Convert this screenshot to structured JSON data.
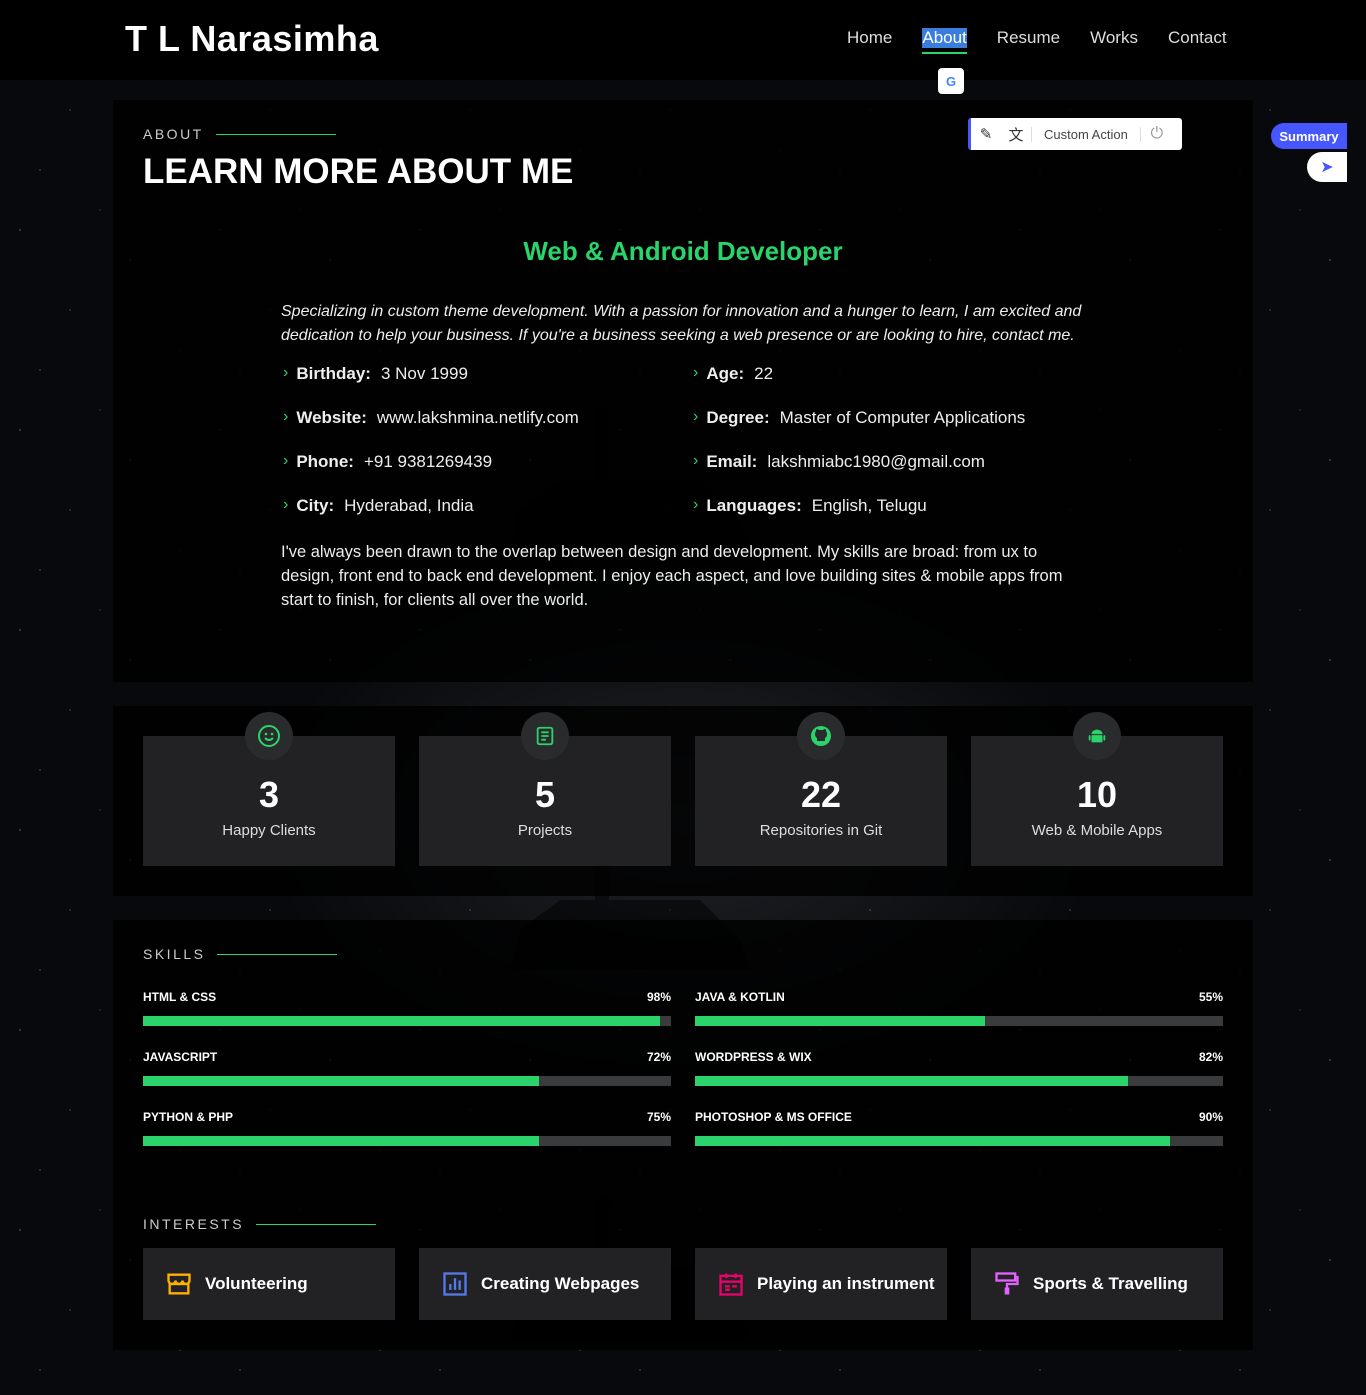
{
  "header": {
    "logo": "T L Narasimha",
    "nav": [
      "Home",
      "About",
      "Resume",
      "Works",
      "Contact"
    ],
    "active_nav": "About"
  },
  "toolbar": {
    "custom_action_label": "Custom Action"
  },
  "summary": {
    "label": "Summary"
  },
  "about": {
    "section_label": "ABOUT",
    "title": "LEARN MORE ABOUT ME",
    "role": "Web & Android Developer",
    "intro": "Specializing in custom theme development. With a passion for innovation and a hunger to learn, I am excited and dedication to help your business. If you're a business seeking a web presence or are looking to hire, contact me.",
    "info": [
      {
        "label": "Birthday:",
        "value": "3 Nov 1999"
      },
      {
        "label": "Age:",
        "value": "22"
      },
      {
        "label": "Website:",
        "value": "www.lakshmina.netlify.com"
      },
      {
        "label": "Degree:",
        "value": "Master of Computer Applications"
      },
      {
        "label": "Phone:",
        "value": "+91 9381269439"
      },
      {
        "label": "Email:",
        "value": "lakshmiabc1980@gmail.com"
      },
      {
        "label": "City:",
        "value": "Hyderabad, India"
      },
      {
        "label": "Languages:",
        "value": "English, Telugu"
      }
    ],
    "bio": "I've always been drawn to the overlap between design and development. My skills are broad: from ux to design, front end to back end development. I enjoy each aspect, and love building sites & mobile apps from start to finish, for clients all over the world."
  },
  "stats": [
    {
      "number": "3",
      "label": "Happy Clients",
      "icon": "smiley-icon"
    },
    {
      "number": "5",
      "label": "Projects",
      "icon": "document-list-icon"
    },
    {
      "number": "22",
      "label": "Repositories in Git",
      "icon": "github-icon"
    },
    {
      "number": "10",
      "label": "Web & Mobile Apps",
      "icon": "android-icon"
    }
  ],
  "skills": {
    "section_label": "SKILLS",
    "items": [
      {
        "name": "HTML & CSS",
        "percent_label": "98%",
        "percent": 98
      },
      {
        "name": "JAVA & KOTLIN",
        "percent_label": "55%",
        "percent": 55
      },
      {
        "name": "JAVASCRIPT",
        "percent_label": "72%",
        "percent": 75
      },
      {
        "name": "WORDPRESS & WIX",
        "percent_label": "82%",
        "percent": 82
      },
      {
        "name": "PYTHON & PHP",
        "percent_label": "75%",
        "percent": 75
      },
      {
        "name": "PHOTOSHOP & MS OFFICE",
        "percent_label": "90%",
        "percent": 90
      }
    ]
  },
  "interests": {
    "section_label": "INTERESTS",
    "items": [
      {
        "label": "Volunteering",
        "icon": "store-icon",
        "color": "#ffb300"
      },
      {
        "label": "Creating Webpages",
        "icon": "bar-chart-icon",
        "color": "#5578eb"
      },
      {
        "label": "Playing an instrument",
        "icon": "calendar-icon",
        "color": "#e80368"
      },
      {
        "label": "Sports & Travelling",
        "icon": "paint-roller-icon",
        "color": "#e361ff"
      }
    ]
  },
  "colors": {
    "accent": "#2bd46b",
    "highlight": "#3b7ddd"
  }
}
